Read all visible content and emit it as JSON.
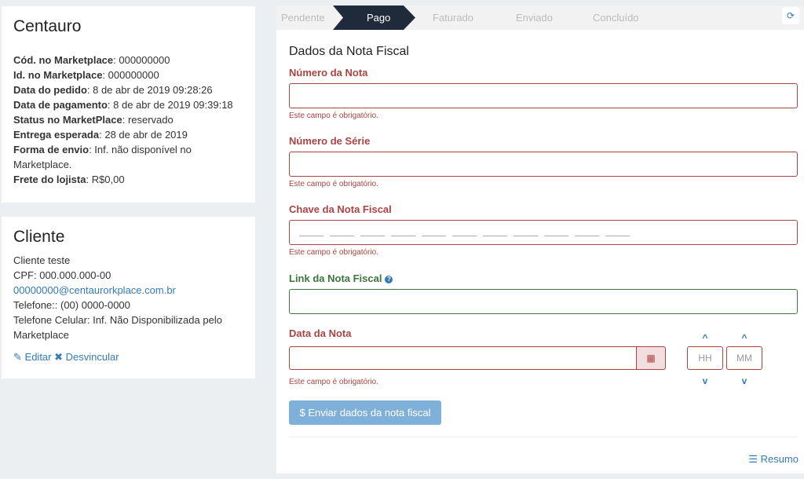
{
  "store": {
    "title": "Centauro",
    "rows": [
      {
        "label": "Cód. no Marketplace",
        "value": ": 000000000"
      },
      {
        "label": "Id. no Marketplace",
        "value": ": 000000000"
      },
      {
        "label": "Data do pedido",
        "value": ": 8 de abr de 2019 09:28:26"
      },
      {
        "label": "Data de pagamento",
        "value": ": 8 de abr de 2019 09:39:18"
      },
      {
        "label": "Status no MarketPlace",
        "value": ": reservado"
      },
      {
        "label": "Entrega esperada",
        "value": ": 28 de abr de 2019"
      },
      {
        "label": "Forma de envio",
        "value": ": Inf. não disponível no Marketplace."
      },
      {
        "label": "Frete do lojista",
        "value": ": R$0,00"
      }
    ]
  },
  "client": {
    "title": "Cliente",
    "name": "Cliente teste",
    "cpf": "CPF: 000.000.000-00",
    "email": "00000000@centaurorkplace.com.br",
    "phone": "Telefone:: (00) 0000-0000",
    "mobile": "Telefone Celular: Inf. Não Disponibilizada pelo Marketplace",
    "edit_label": "Editar",
    "unlink_label": "Desvincular"
  },
  "steps": [
    "Pendente",
    "Pago",
    "Faturado",
    "Enviado",
    "Concluído"
  ],
  "active_step": "Pago",
  "form": {
    "title": "Dados da Nota Fiscal",
    "numero_label": "Número da Nota",
    "serie_label": "Número de Série",
    "chave_label": "Chave da Nota Fiscal",
    "chave_mask": "____ ____ ____ ____ ____ ____ ____ ____ ____ ____ ____",
    "link_label": "Link da Nota Fiscal",
    "data_label": "Data da Nota",
    "error_msg": "Este campo é obrigatório.",
    "hour_placeholder": "HH",
    "minute_placeholder": "MM",
    "send_label": "$ Enviar dados da nota fiscal",
    "resumo_label": "Resumo"
  },
  "colors": {
    "error": "#a94442",
    "ok": "#3c763d",
    "link": "#337ab7",
    "step_active": "#1f2b3a"
  }
}
